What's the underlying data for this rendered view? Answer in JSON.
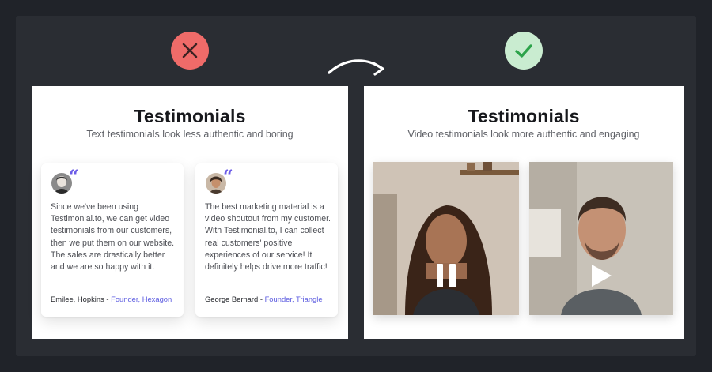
{
  "comparison": {
    "bad_badge": "close-icon",
    "good_badge": "check-icon",
    "arrow_icon": "curved-arrow-icon",
    "colors": {
      "bad": "#ef6b69",
      "good": "#c9ecd0",
      "accent": "#5b5be0"
    }
  },
  "left_panel": {
    "title": "Testimonials",
    "subtitle": "Text testimonials look less authentic and boring",
    "cards": [
      {
        "text": "Since we've been using Testimonial.to, we can get video testimonials from our customers, then we put them on our website. The sales are drastically better and we are so happy with it.",
        "author": "Emilee, Hopkins",
        "separator": " - ",
        "role": "Founder, Hexagon"
      },
      {
        "text": "The best marketing material is a video shoutout from my customer. With Testimonial.to, I can collect real customers' positive experiences of our service! It definitely helps drive more traffic!",
        "author": "George Bernard",
        "separator": " - ",
        "role": "Founder, Triangle"
      }
    ]
  },
  "right_panel": {
    "title": "Testimonials",
    "subtitle": "Video testimonials look more authentic and engaging",
    "videos": [
      {
        "state": "playing",
        "control_icon": "pause-icon"
      },
      {
        "state": "paused",
        "control_icon": "play-icon"
      }
    ]
  }
}
